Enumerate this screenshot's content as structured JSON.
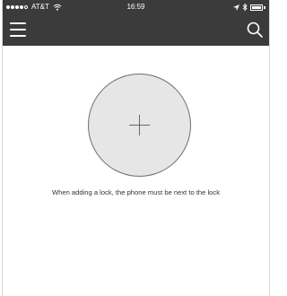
{
  "status_bar": {
    "carrier": "AT&T",
    "time": "16:59"
  },
  "nav": {
    "menu_icon": "hamburger-menu-icon",
    "search_icon": "search-icon"
  },
  "main": {
    "add_lock_icon": "plus-icon",
    "hint_text": "When adding a lock, the phone must be next to the lock"
  },
  "colors": {
    "header_bg": "#3b3b3b",
    "circle_fill": "#e6e6e6",
    "circle_border": "#6e6e6e"
  }
}
